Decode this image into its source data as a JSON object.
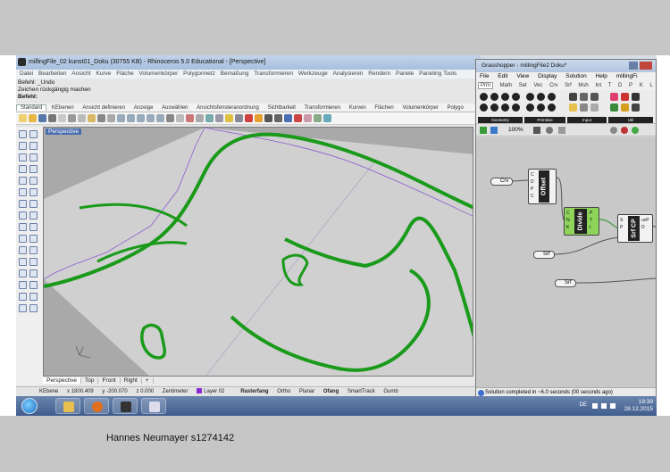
{
  "caption": "Hannes Neumayer s1274142",
  "rhino": {
    "title": "millingFile_02 kunst01_Doku (30755 KB) - Rhinoceros 5.0 Educational - [Perspective]",
    "menu": [
      "Datei",
      "Bearbeiten",
      "Ansicht",
      "Kurve",
      "Fläche",
      "Volumenkörper",
      "Polygonnetz",
      "Bemaßung",
      "Transformieren",
      "Werkzeuge",
      "Analysieren",
      "Rendern",
      "Panele",
      "Paneling Tools"
    ],
    "command_history": [
      "Befehl: _Undo",
      "Zeichen rückgängig machen"
    ],
    "command_prompt": "Befehl:",
    "toolbar_tabs": [
      "Standard",
      "KEbenen",
      "Ansicht definieren",
      "Anzeige",
      "Auswählen",
      "Ansichtsfensteranordnung",
      "Sichtbarkeit",
      "Transformieren",
      "Kurven",
      "Flächen",
      "Volumenkörper",
      "Polygo"
    ],
    "viewport_label": "Perspective",
    "view_tabs": [
      "Perspective",
      "Top",
      "Front",
      "Right",
      "+"
    ],
    "status": {
      "layer_scope": "KEbene",
      "x": "x 1800.409",
      "y": "y -200.070",
      "z": "z 0.000",
      "units": "Zentimeter",
      "layer": "Layer 02",
      "toggles": [
        "Rasterfang",
        "Ortho",
        "Planar",
        "Ofang",
        "SmartTrack",
        "Gumb"
      ]
    }
  },
  "grasshopper": {
    "title": "Grasshopper - millingFile2 Doku*",
    "menu": [
      "File",
      "Edit",
      "View",
      "Display",
      "Solution",
      "Help"
    ],
    "doc_name": "millingFi",
    "tabs": [
      "Prm",
      "Math",
      "Set",
      "Vec",
      "Crv",
      "Srf",
      "Msh",
      "Int",
      "T",
      "D",
      "P",
      "K",
      "L"
    ],
    "ribbon_groups": [
      "Geometry",
      "Primitive",
      "Input",
      "Util"
    ],
    "zoom": "100%",
    "components": {
      "curve_param": "Crv",
      "offset_label": "Offset",
      "offset_inputs": [
        "C",
        "D",
        "P",
        "C"
      ],
      "divide_label": "Divide",
      "divide_inputs": [
        "C",
        "N",
        "K"
      ],
      "divide_outputs": [
        "P",
        "T",
        "t"
      ],
      "srf_param_1": "Srf",
      "srf_param_2": "Srf",
      "srfcp_label": "Srf CP",
      "srfcp_inputs": [
        "S",
        "P"
      ],
      "srfcp_outputs": [
        "uvP",
        "D"
      ]
    },
    "status": "Solution completed in ~6.0 seconds (00 seconds ago)"
  },
  "taskbar": {
    "language": "DE",
    "time": "19:39",
    "date": "28.12.2015"
  }
}
